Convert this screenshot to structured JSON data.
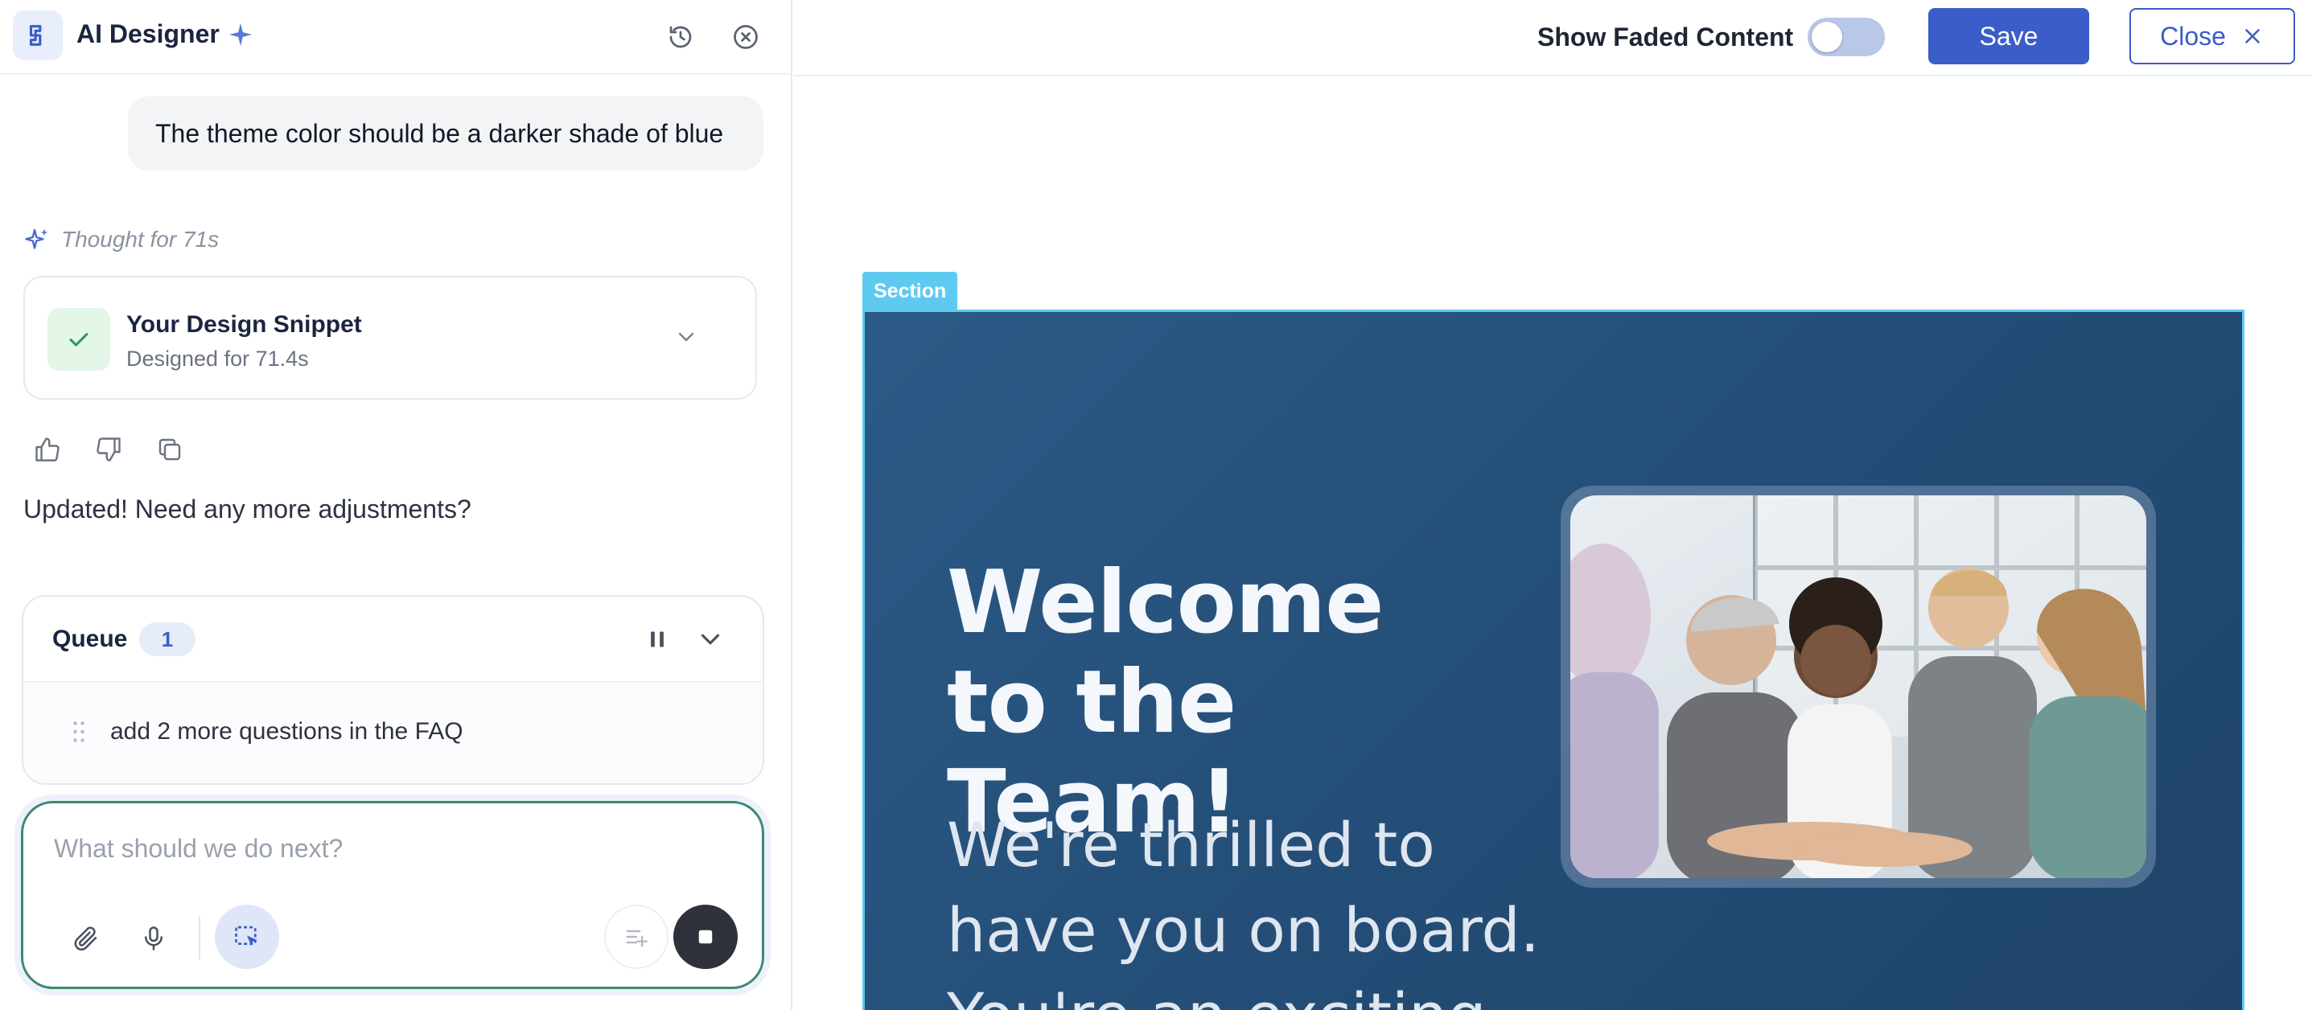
{
  "left_panel": {
    "title": "AI Designer",
    "user_message": "The theme color should be a darker shade of blue",
    "thought": "Thought for 71s",
    "snippet": {
      "title": "Your Design Snippet",
      "subtitle": "Designed for 71.4s"
    },
    "reply": "Updated! Need any more adjustments?",
    "queue": {
      "title": "Queue",
      "count": "1",
      "items": [
        {
          "text": "add 2 more questions in the FAQ"
        }
      ]
    },
    "composer": {
      "placeholder": "What should we do next?"
    }
  },
  "topbar": {
    "faded_label": "Show Faded Content",
    "faded_on": false,
    "save_label": "Save",
    "close_label": "Close"
  },
  "canvas": {
    "section_tag": "Section",
    "hero_title": "Welcome to the Team!",
    "hero_subtitle": "We're thrilled to have you on board. You're an exciting"
  },
  "colors": {
    "accent": "#3a5dc9",
    "section_outline": "#5fcaf0",
    "hero_bg": "#224b74",
    "composer_border": "#3b8a6e"
  }
}
